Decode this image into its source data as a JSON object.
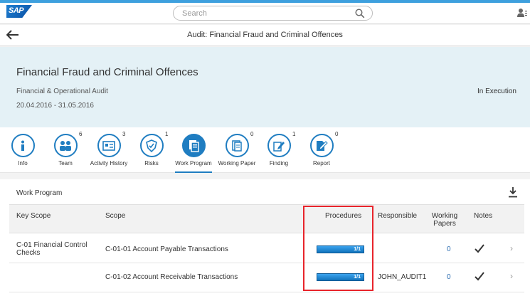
{
  "shell": {
    "logo_text": "SAP",
    "search_placeholder": "Search",
    "icons": [
      "search-icon",
      "user-menu-icon"
    ]
  },
  "header": {
    "title": "Audit: Financial Fraud and Criminal Offences",
    "back_icon": "arrow-left-icon"
  },
  "object": {
    "title": "Financial Fraud and Criminal Offences",
    "subtitle": "Financial & Operational Audit",
    "date_range": "20.04.2016 - 31.05.2016",
    "status": "In Execution"
  },
  "tabs": [
    {
      "label": "Info",
      "count": "",
      "icon": "info-icon"
    },
    {
      "label": "Team",
      "count": "6",
      "icon": "team-icon"
    },
    {
      "label": "Activity History",
      "count": "3",
      "icon": "activity-history-icon"
    },
    {
      "label": "Risks",
      "count": "1",
      "icon": "risk-icon"
    },
    {
      "label": "Work Program",
      "count": "",
      "icon": "work-program-icon",
      "active": true
    },
    {
      "label": "Working Paper",
      "count": "0",
      "icon": "working-paper-icon"
    },
    {
      "label": "Finding",
      "count": "1",
      "icon": "finding-icon"
    },
    {
      "label": "Report",
      "count": "0",
      "icon": "report-icon"
    }
  ],
  "work_program": {
    "title": "Work Program",
    "download_icon": "download-icon",
    "columns": [
      "Key Scope",
      "Scope",
      "Procedures",
      "Responsible",
      "Working Papers",
      "Notes"
    ],
    "rows": [
      {
        "key_scope": "C-01 Financial Control Checks",
        "scope": "C-01-01 Account Payable Transactions",
        "procedures": "1/1",
        "procedures_progress": 1.0,
        "responsible": "",
        "working_papers": "0",
        "notes_icon": "checkmark-icon"
      },
      {
        "key_scope": "",
        "scope": "C-01-02 Account Receivable Transactions",
        "procedures": "1/1",
        "procedures_progress": 1.0,
        "responsible": "JOHN_AUDIT1",
        "working_papers": "0",
        "notes_icon": "checkmark-icon"
      }
    ]
  },
  "colors": {
    "accent": "#1f7dc1",
    "shell_top_bar": "#3ea0de",
    "object_header_bg": "#e4f1f6",
    "highlight": "#e8242b",
    "progress": "#1e8bd8"
  }
}
